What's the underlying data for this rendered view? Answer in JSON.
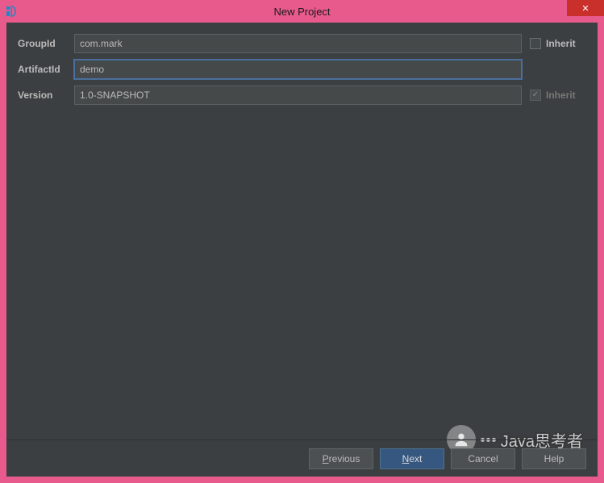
{
  "window": {
    "title": "New Project",
    "close_glyph": "✕"
  },
  "form": {
    "groupId": {
      "label": "GroupId",
      "value": "com.mark",
      "inherit_label": "Inherit"
    },
    "artifactId": {
      "label": "ArtifactId",
      "value": "demo"
    },
    "version": {
      "label": "Version",
      "value": "1.0-SNAPSHOT",
      "inherit_label": "Inherit"
    }
  },
  "buttons": {
    "previous": "Previous",
    "next": "Next",
    "cancel": "Cancel",
    "help": "Help"
  },
  "watermark": {
    "text": "Java思考者"
  }
}
